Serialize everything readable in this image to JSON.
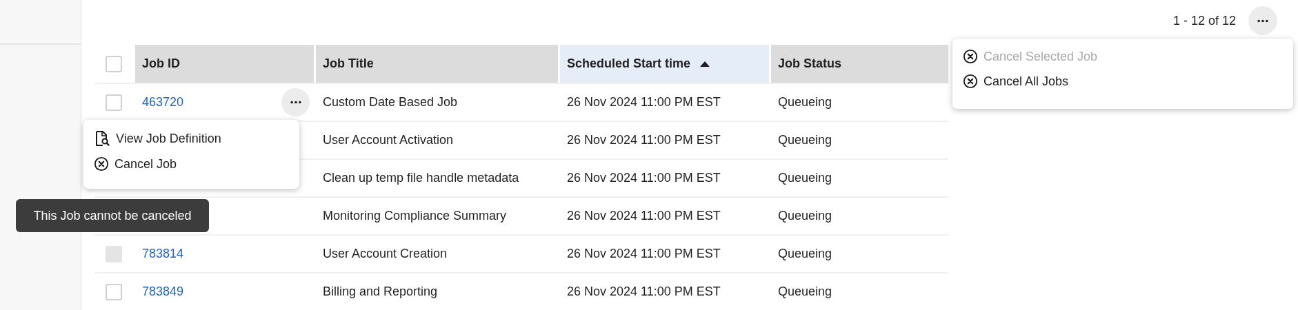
{
  "pagination": {
    "range": "1 - 12 of 12"
  },
  "top_menu": {
    "items": [
      {
        "label": "Cancel Selected Job",
        "disabled": true
      },
      {
        "label": "Cancel All Jobs",
        "disabled": false
      }
    ]
  },
  "table": {
    "select_all": {
      "checked": false
    },
    "columns": [
      {
        "label": "Job ID",
        "sorted": false
      },
      {
        "label": "Job Title",
        "sorted": false
      },
      {
        "label": "Scheduled Start time",
        "sorted": true
      },
      {
        "label": "Job Status",
        "sorted": false
      }
    ],
    "rows": [
      {
        "checkbox": {
          "checked": false,
          "disabled": false
        },
        "job_id": "463720",
        "title": "Custom Date Based Job",
        "start": "26 Nov 2024 11:00 PM EST",
        "status": "Queueing",
        "menu": {
          "items": [
            {
              "label": "View Job Definition",
              "kind": "view"
            },
            {
              "label": "Cancel Job",
              "kind": "cancel"
            }
          ]
        }
      },
      {
        "title": "User Account Activation",
        "start": "26 Nov 2024 11:00 PM EST",
        "status": "Queueing"
      },
      {
        "title": "Clean up temp file handle metadata",
        "start": "26 Nov 2024 11:00 PM EST",
        "status": "Queueing"
      },
      {
        "title": "Monitoring Compliance Summary",
        "start": "26 Nov 2024 11:00 PM EST",
        "status": "Queueing"
      },
      {
        "checkbox": {
          "checked": false,
          "disabled": true
        },
        "job_id": "783814",
        "title": "User Account Creation",
        "start": "26 Nov 2024 11:00 PM EST",
        "status": "Queueing",
        "tooltip": "This Job cannot be canceled"
      },
      {
        "checkbox": {
          "checked": false,
          "disabled": false
        },
        "job_id": "783849",
        "title": "Billing and Reporting",
        "start": "26 Nov 2024 11:00 PM EST",
        "status": "Queueing"
      }
    ]
  }
}
